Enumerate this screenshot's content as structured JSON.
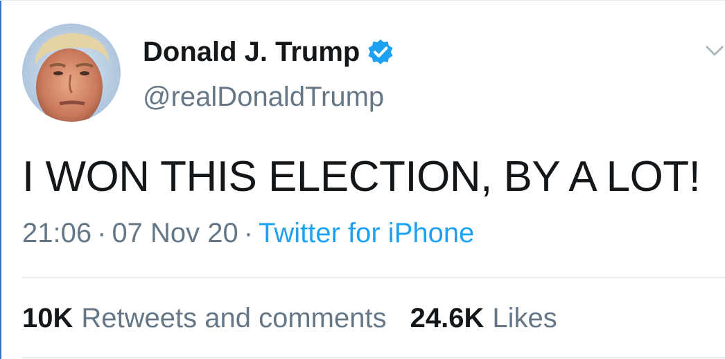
{
  "user": {
    "display_name": "Donald J. Trump",
    "handle": "@realDonaldTrump",
    "verified": true,
    "avatar": "profile-photo"
  },
  "tweet": {
    "text": "I WON THIS ELECTION, BY A LOT!",
    "time": "21:06",
    "date": "07 Nov 20",
    "separator": "·",
    "source": "Twitter for iPhone"
  },
  "stats": {
    "retweets_count": "10K",
    "retweets_label": "Retweets and comments",
    "likes_count": "24.6K",
    "likes_label": "Likes"
  },
  "icons": {
    "verified": "verified-badge-icon",
    "menu": "chevron-down-icon"
  },
  "colors": {
    "text_primary": "#14171a",
    "text_secondary": "#657786",
    "link": "#1da1f2",
    "verified": "#1da1f2",
    "divider": "#e6ecf0"
  }
}
